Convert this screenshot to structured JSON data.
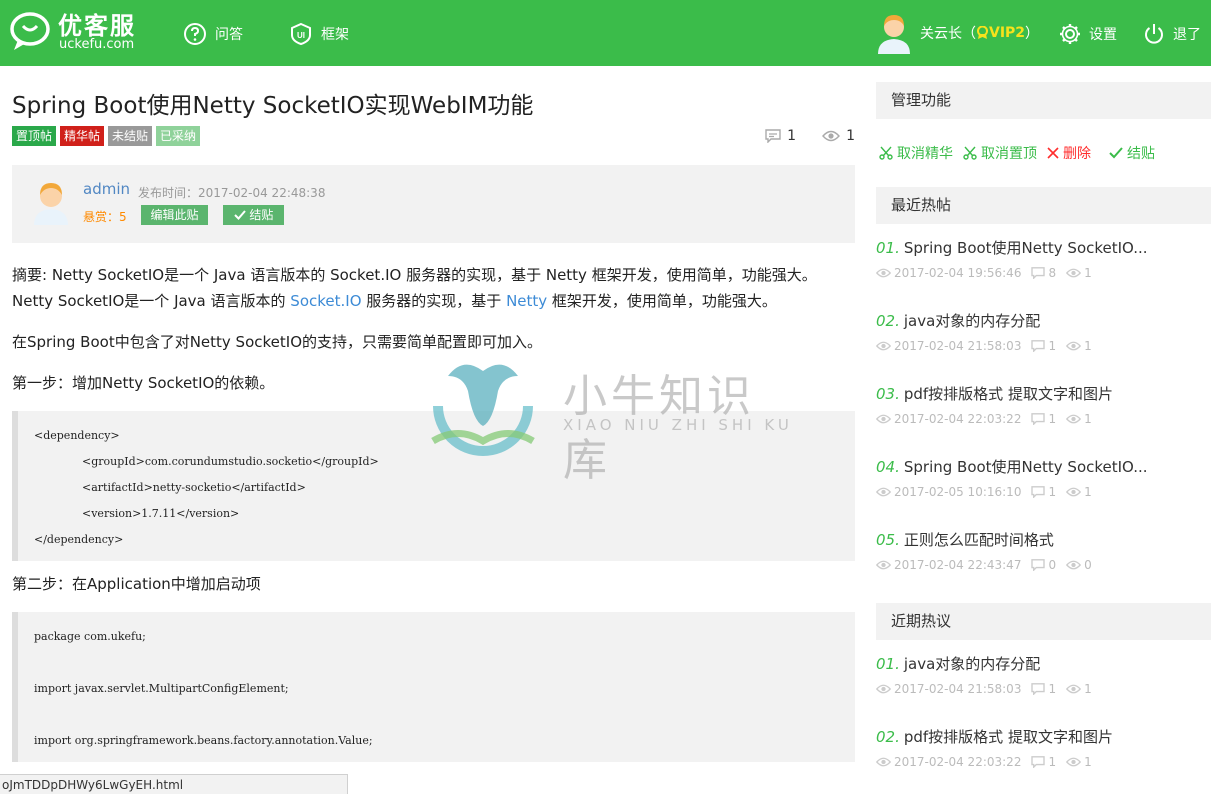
{
  "header": {
    "logo_text": "优客服",
    "logo_sub": "uckefu.com",
    "nav_qa": "问答",
    "nav_framework": "框架",
    "user_name": "关云长（",
    "vip": "VIP2",
    "user_suffix": "）",
    "settings": "设置",
    "logout": "退了",
    "bg_color": "#3bbc4a"
  },
  "post": {
    "title": "Spring Boot使用Netty SocketIO实现WebIM功能",
    "tags": [
      {
        "label": "置顶帖",
        "color": "#2aa84a"
      },
      {
        "label": "精华帖",
        "color": "#d0201a"
      },
      {
        "label": "未结贴",
        "color": "#999999"
      },
      {
        "label": "已采纳",
        "color": "#8fd29a"
      }
    ],
    "comment_count": "1",
    "view_count": "1",
    "author": "admin",
    "time_label": "发布时间：2017-02-04 22:48:38",
    "reward_label": "悬赏：5",
    "edit_button": "编辑此贴",
    "close_button": "结贴"
  },
  "content": {
    "p1": "摘要: Netty SocketIO是一个 Java 语言版本的 Socket.IO 服务器的实现，基于 Netty 框架开发，使用简单，功能强大。",
    "p2_a": "Netty SocketIO是一个 Java 语言版本的 ",
    "p2_link1": "Socket.IO",
    "p2_b": " 服务器的实现，基于 ",
    "p2_link2": "Netty",
    "p2_c": " 框架开发，使用简单，功能强大。",
    "p3": "在Spring Boot中包含了对Netty SocketIO的支持，只需要简单配置即可加入。",
    "p4": "第一步：增加Netty SocketIO的依赖。",
    "code1": {
      "l1": "<dependency>",
      "l2": "<groupId>com.corundumstudio.socketio</groupId>",
      "l3": "<artifactId>netty-socketio</artifactId>",
      "l4": "<version>1.7.11</version>",
      "l5": "</dependency>"
    },
    "p5": "第二步：在Application中增加启动项",
    "code2": {
      "l1": "package com.ukefu;",
      "l2": "import javax.servlet.MultipartConfigElement;",
      "l3": "import org.springframework.beans.factory.annotation.Value;"
    }
  },
  "statusbar": "oJmTDDpDHWy6LwGyEH.html",
  "sidebar": {
    "admin_title": "管理功能",
    "ops": {
      "unfeature": "取消精华",
      "unpin": "取消置顶",
      "delete": "删除",
      "close": "结贴"
    },
    "hot_title": "最近热帖",
    "hot": [
      {
        "num": "01.",
        "title": "Spring Boot使用Netty SocketIO...",
        "date": "2017-02-04 19:56:46",
        "comments": "8",
        "views": "1"
      },
      {
        "num": "02.",
        "title": "java对象的内存分配",
        "date": "2017-02-04 21:58:03",
        "comments": "1",
        "views": "1"
      },
      {
        "num": "03.",
        "title": "pdf按排版格式 提取文字和图片",
        "date": "2017-02-04 22:03:22",
        "comments": "1",
        "views": "1"
      },
      {
        "num": "04.",
        "title": "Spring Boot使用Netty SocketIO...",
        "date": "2017-02-05 10:16:10",
        "comments": "1",
        "views": "1"
      },
      {
        "num": "05.",
        "title": "正则怎么匹配时间格式",
        "date": "2017-02-04 22:43:47",
        "comments": "0",
        "views": "0"
      }
    ],
    "discuss_title": "近期热议",
    "discuss": [
      {
        "num": "01.",
        "title": "java对象的内存分配",
        "date": "2017-02-04 21:58:03",
        "comments": "1",
        "views": "1"
      },
      {
        "num": "02.",
        "title": "pdf按排版格式 提取文字和图片",
        "date": "2017-02-04 22:03:22",
        "comments": "1",
        "views": "1"
      }
    ]
  },
  "watermark": {
    "cn": "小牛知识库",
    "en": "XIAO NIU ZHI SHI KU"
  }
}
